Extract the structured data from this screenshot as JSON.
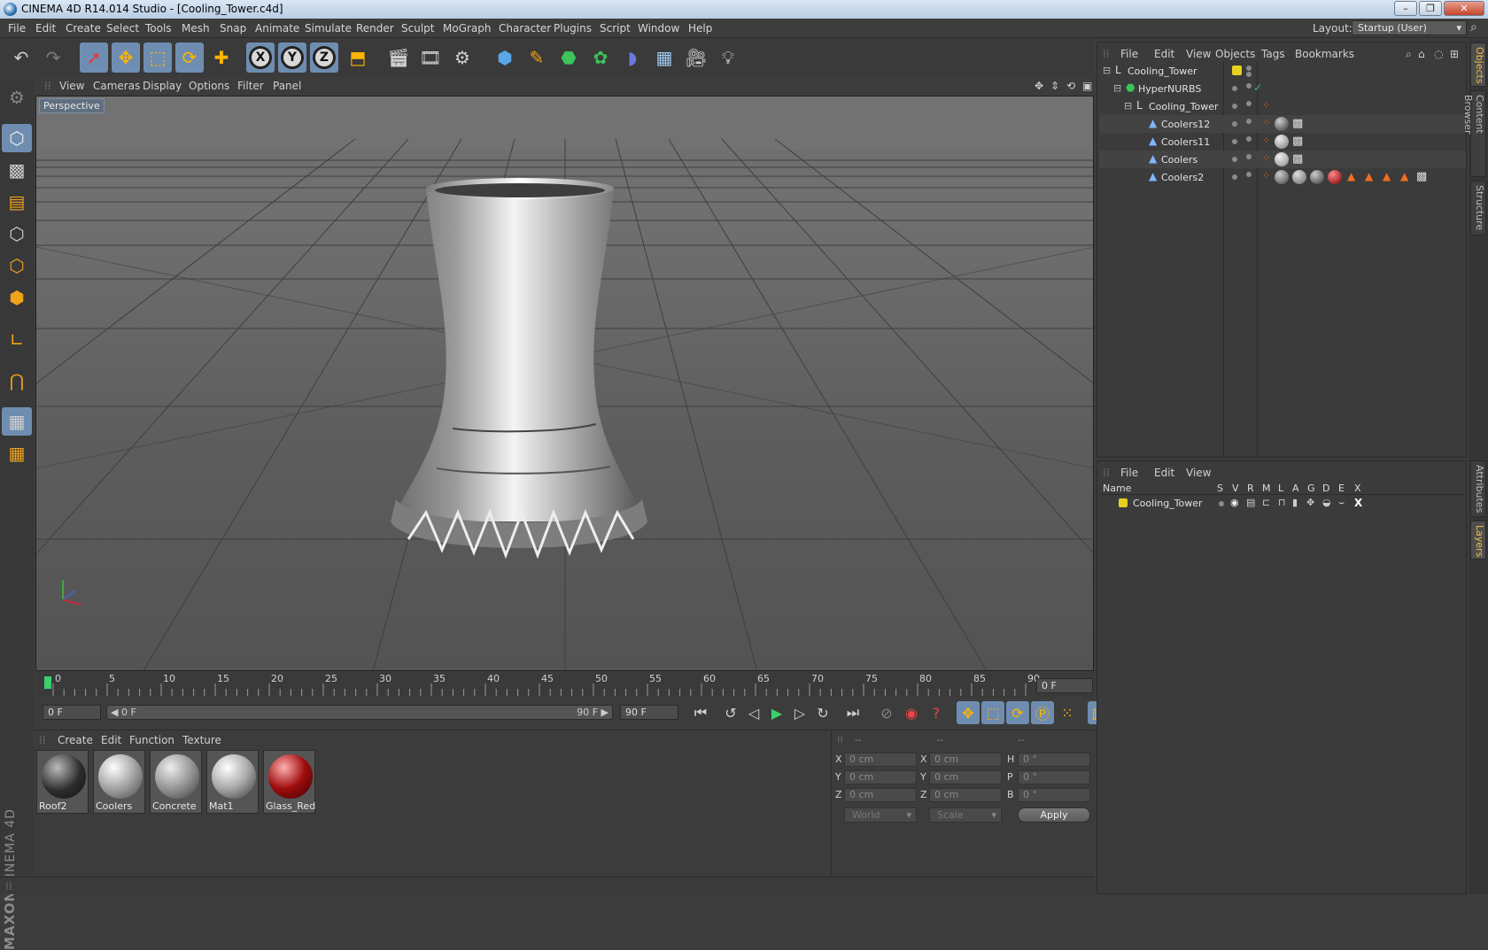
{
  "window": {
    "title": "CINEMA 4D R14.014 Studio - [Cooling_Tower.c4d]",
    "min": "–",
    "max": "❐",
    "close": "✕"
  },
  "menu": [
    "File",
    "Edit",
    "Create",
    "Select",
    "Tools",
    "Mesh",
    "Snap",
    "Animate",
    "Simulate",
    "Render",
    "Sculpt",
    "MoGraph",
    "Character",
    "Plugins",
    "Script",
    "Window",
    "Help"
  ],
  "layout": {
    "label": "Layout:",
    "value": "Startup (User)"
  },
  "viewport": {
    "menu": [
      "View",
      "Cameras",
      "Display",
      "Options",
      "Filter",
      "Panel"
    ],
    "label": "Perspective"
  },
  "timeline": {
    "ticks": [
      "0",
      "5",
      "10",
      "15",
      "20",
      "25",
      "30",
      "35",
      "40",
      "45",
      "50",
      "55",
      "60",
      "65",
      "70",
      "75",
      "80",
      "85",
      "90"
    ],
    "current_frame": "0 F",
    "start_field": "0 F",
    "range_start": "◀ 0 F",
    "range_end": "90 F ▶",
    "end_field": "90 F"
  },
  "materials": {
    "menu": [
      "Create",
      "Edit",
      "Function",
      "Texture"
    ],
    "items": [
      {
        "name": "Roof2",
        "color": "#2c2c2c"
      },
      {
        "name": "Coolers",
        "color": "#9a9a9a"
      },
      {
        "name": "Concrete",
        "color": "#8d8d8d"
      },
      {
        "name": "Mat1",
        "color": "#a8a8a8"
      },
      {
        "name": "Glass_Red",
        "color": "#9e0c0c"
      }
    ]
  },
  "coords": {
    "headers": [
      "--",
      "--",
      "--"
    ],
    "pos_labels": [
      "X",
      "Y",
      "Z"
    ],
    "size_labels": [
      "X",
      "Y",
      "Z"
    ],
    "rot_labels": [
      "H",
      "P",
      "B"
    ],
    "pos_values": [
      "0 cm",
      "0 cm",
      "0 cm"
    ],
    "size_values": [
      "0 cm",
      "0 cm",
      "0 cm"
    ],
    "rot_values": [
      "0 °",
      "0 °",
      "0 °"
    ],
    "mode": "World",
    "type": "Scale",
    "apply": "Apply"
  },
  "objects": {
    "menu": [
      "File",
      "Edit",
      "View",
      "Objects",
      "Tags",
      "Bookmarks"
    ],
    "rows": [
      {
        "name": "Cooling_Tower",
        "icon": "null-icon"
      },
      {
        "name": "HyperNURBS",
        "icon": "hypernurbs-icon"
      },
      {
        "name": "Cooling_Tower",
        "icon": "null-icon"
      },
      {
        "name": "Coolers12",
        "icon": "polygon-icon"
      },
      {
        "name": "Coolers11",
        "icon": "polygon-icon"
      },
      {
        "name": "Coolers",
        "icon": "polygon-icon"
      },
      {
        "name": "Coolers2",
        "icon": "polygon-icon"
      }
    ]
  },
  "layers": {
    "menu": [
      "File",
      "Edit",
      "View"
    ],
    "columns": [
      "Name",
      "S",
      "V",
      "R",
      "M",
      "L",
      "A",
      "G",
      "D",
      "E",
      "X"
    ],
    "rows": [
      {
        "name": "Cooling_Tower",
        "color": "#e6d21e"
      }
    ]
  },
  "side_tabs": [
    "Objects",
    "Content Browser",
    "Structure",
    "Attributes",
    "Layers"
  ],
  "colors": {
    "accent": "#6f8db0",
    "background": "#3c3c3c"
  }
}
